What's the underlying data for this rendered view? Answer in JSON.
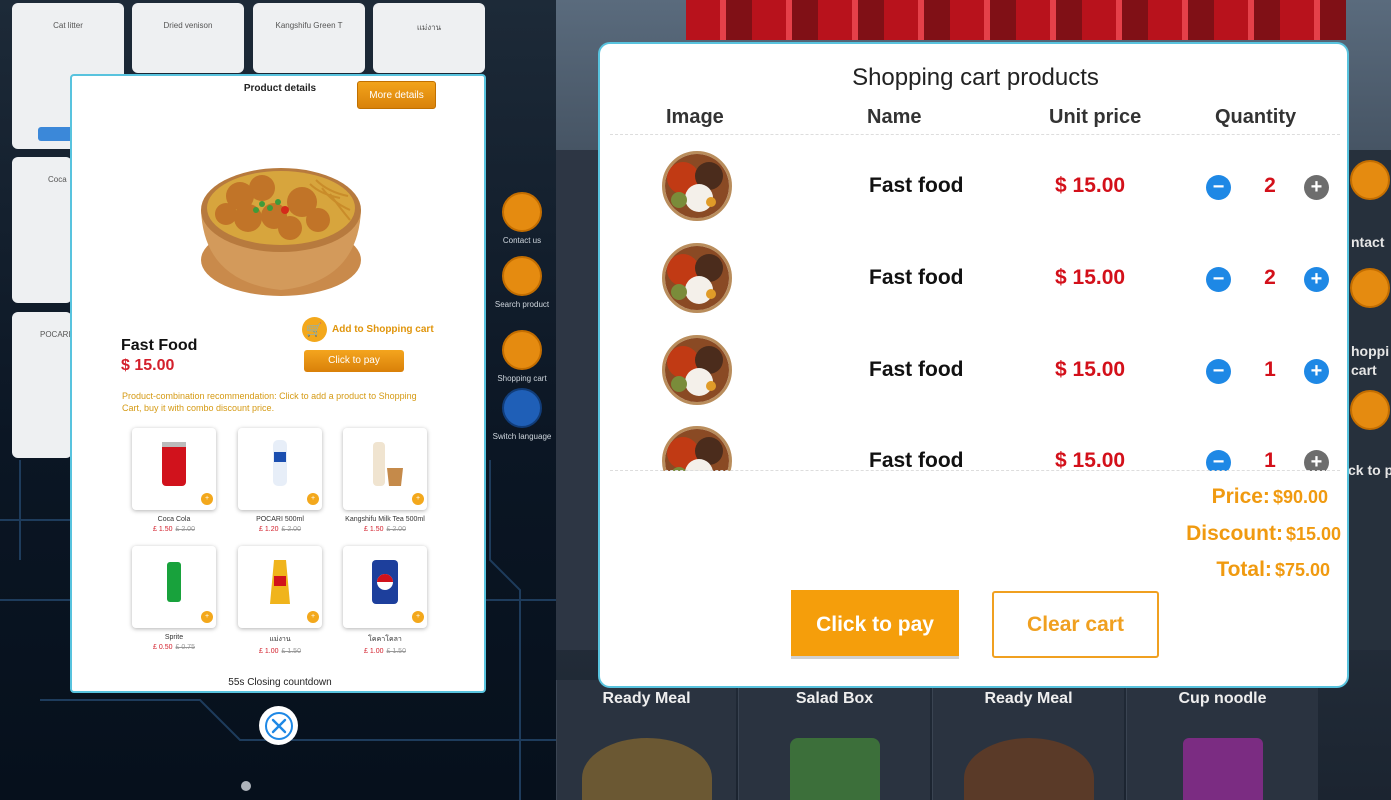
{
  "background": {
    "top_tiles": [
      "Cat litter",
      "Dried venison",
      "Kangshifu Green T",
      "แม่งาน"
    ],
    "side_tiles": [
      "Coca",
      "POCARI"
    ],
    "side_menu": [
      {
        "label": "Contact us",
        "icon": "phone-icon"
      },
      {
        "label": "Search product",
        "icon": "search-icon"
      },
      {
        "label": "Shopping cart",
        "icon": "cart-icon"
      },
      {
        "label": "Switch language",
        "icon": "globe-icon"
      }
    ],
    "right_side_menu": [
      "ntact",
      "hoppi cart",
      "ck to p"
    ],
    "bottom_items": [
      "Ready Meal",
      "Salad Box",
      "Ready Meal",
      "Cup noodle"
    ]
  },
  "product_details": {
    "title": "Product details",
    "more_details_label": "More details",
    "product_name": "Fast Food",
    "product_price": "$ 15.00",
    "add_to_cart_label": "Add to Shopping cart",
    "click_to_pay_label": "Click to pay",
    "combo_text": "Product-combination recommendation: Click to add a product to Shopping Cart, buy it with combo discount price.",
    "combo_items": [
      {
        "name": "Coca Cola",
        "price": "£ 1.50",
        "old_price": "£ 2.00",
        "color": "#d1121c"
      },
      {
        "name": "POCARI 500ml",
        "price": "£ 1.20",
        "old_price": "£ 2.00",
        "color": "#1b4fb0"
      },
      {
        "name": "Kangshifu Milk Tea 500ml",
        "price": "£ 1.50",
        "old_price": "£ 2.00",
        "color": "#c58a4a"
      },
      {
        "name": "Sprite",
        "price": "£ 0.50",
        "old_price": "£ 0.75",
        "color": "#18a23c"
      },
      {
        "name": "แม่งาน",
        "price": "£ 1.00",
        "old_price": "£ 1.50",
        "color": "#f0b41c"
      },
      {
        "name": "โคคาโคลา",
        "price": "£ 1.00",
        "old_price": "£ 1.50",
        "color": "#1d3f9c"
      }
    ],
    "countdown": "55s Closing countdown"
  },
  "cart": {
    "title": "Shopping cart products",
    "headers": {
      "image": "Image",
      "name": "Name",
      "unit_price": "Unit price",
      "quantity": "Quantity"
    },
    "rows": [
      {
        "name": "Fast food",
        "price": "$ 15.00",
        "qty": "2",
        "plus_state": "disabled"
      },
      {
        "name": "Fast food",
        "price": "$ 15.00",
        "qty": "2",
        "plus_state": "enabled"
      },
      {
        "name": "Fast food",
        "price": "$ 15.00",
        "qty": "1",
        "plus_state": "enabled"
      },
      {
        "name": "Fast food",
        "price": "$ 15.00",
        "qty": "1",
        "plus_state": "disabled"
      }
    ],
    "price_label": "Price:",
    "price_value": "$90.00",
    "discount_label": "Discount:",
    "discount_value": "$15.00",
    "total_label": "Total:",
    "total_value": "$75.00",
    "pay_label": "Click to pay",
    "clear_label": "Clear cart"
  },
  "colors": {
    "accent_orange": "#f59e0b",
    "price_red": "#d3101a",
    "qty_blue": "#1e88e5",
    "modal_border": "#58c3de"
  }
}
